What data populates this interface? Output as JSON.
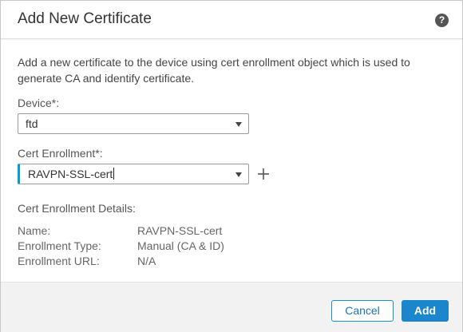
{
  "dialog": {
    "title": "Add New Certificate",
    "help_icon": "help-circle-icon",
    "help_glyph": "?"
  },
  "intro": "Add a new certificate to the device using cert enrollment object which is used to generate CA and identify certificate.",
  "device": {
    "label": "Device*:",
    "value": "ftd"
  },
  "cert_enrollment": {
    "label": "Cert Enrollment*:",
    "value": "RAVPN-SSL-cert",
    "add_icon": "plus-icon"
  },
  "details": {
    "title": "Cert Enrollment Details:",
    "rows": [
      {
        "key": "Name:",
        "value": "RAVPN-SSL-cert"
      },
      {
        "key": "Enrollment Type:",
        "value": "Manual (CA & ID)"
      },
      {
        "key": "Enrollment URL:",
        "value": "N/A"
      }
    ]
  },
  "footer": {
    "cancel_label": "Cancel",
    "add_label": "Add"
  },
  "colors": {
    "accent": "#049fd9",
    "primary_button": "#1b86cc",
    "footer_bg": "#f2f2f2"
  }
}
